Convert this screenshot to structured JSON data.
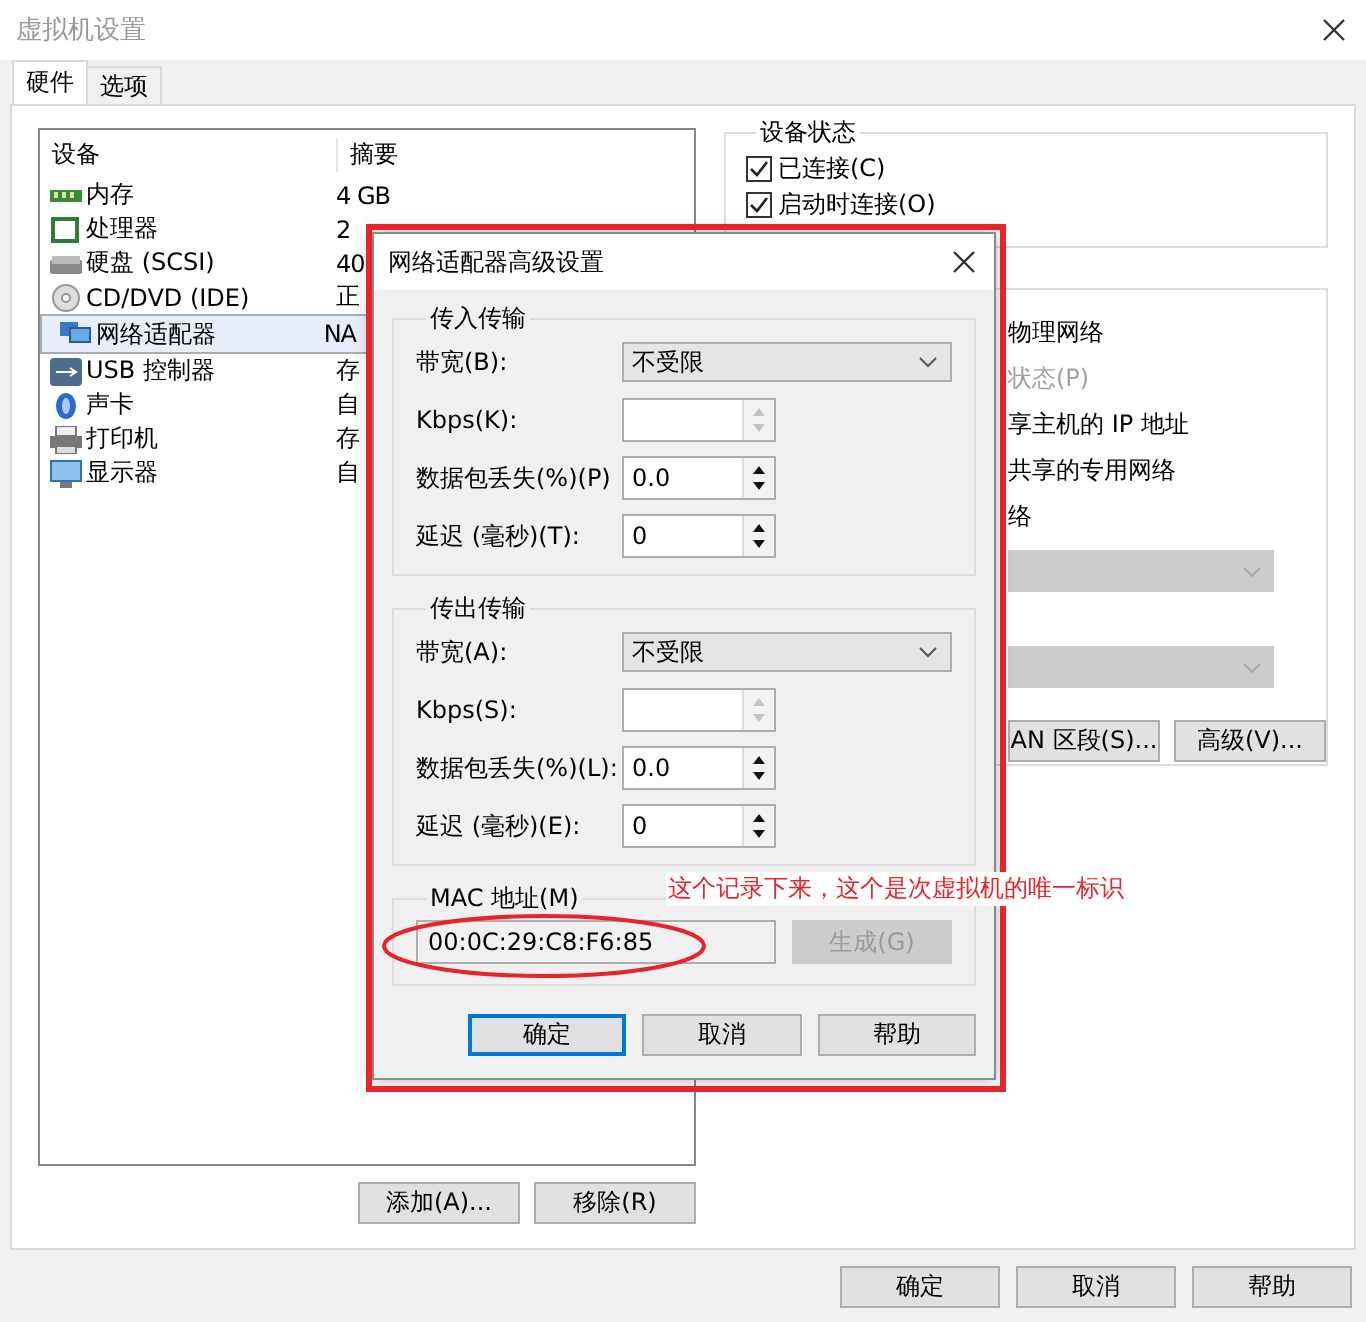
{
  "window": {
    "title": "虚拟机设置"
  },
  "tabs": [
    {
      "label": "硬件",
      "selected": true
    },
    {
      "label": "选项",
      "selected": false
    }
  ],
  "device_list": {
    "columns": [
      "设备",
      "摘要"
    ],
    "rows": [
      {
        "device": "内存",
        "summary": "4 GB",
        "selected": false
      },
      {
        "device": "处理器",
        "summary": "2",
        "selected": false
      },
      {
        "device": "硬盘 (SCSI)",
        "summary": "40",
        "selected": false
      },
      {
        "device": "CD/DVD (IDE)",
        "summary": "正",
        "selected": false
      },
      {
        "device": "网络适配器",
        "summary": "NA",
        "selected": true
      },
      {
        "device": "USB 控制器",
        "summary": "存",
        "selected": false
      },
      {
        "device": "声卡",
        "summary": "自",
        "selected": false
      },
      {
        "device": "打印机",
        "summary": "存",
        "selected": false
      },
      {
        "device": "显示器",
        "summary": "自",
        "selected": false
      }
    ]
  },
  "list_buttons": [
    "添加(A)...",
    "移除(R)"
  ],
  "device_status": {
    "title": "设备状态",
    "options": [
      {
        "label": "已连接(C)",
        "checked": true
      },
      {
        "label": "启动时连接(O)",
        "checked": true
      }
    ]
  },
  "connection": {
    "lines": [
      {
        "text": "物理网络",
        "disabled": false
      },
      {
        "text": "状态(P)",
        "disabled": true
      },
      {
        "text": "享主机的 IP 地址",
        "disabled": false
      },
      {
        "text": "共享的专用网络",
        "disabled": false
      },
      {
        "text": "络",
        "disabled": false
      }
    ],
    "dropdowns": [
      {
        "disabled": true
      },
      {
        "disabled": true
      }
    ],
    "buttons": [
      "AN 区段(S)...",
      "高级(V)..."
    ]
  },
  "footer_buttons": [
    "确定",
    "取消",
    "帮助"
  ],
  "dialog": {
    "title": "网络适配器高级设置",
    "groups": [
      {
        "title": "传入传输",
        "bandwidth": {
          "label": "带宽(B):",
          "value": "不受限"
        },
        "fields": [
          {
            "label": "Kbps(K):",
            "disabled": true
          },
          {
            "label": "数据包丢失(%)(P)",
            "value": "0.0",
            "disabled": false
          },
          {
            "label": "延迟 (毫秒)(T):",
            "value": "0",
            "disabled": false
          }
        ]
      },
      {
        "title": "传出传输",
        "bandwidth": {
          "label": "带宽(A):",
          "value": "不受限"
        },
        "fields": [
          {
            "label": "Kbps(S):",
            "disabled": true
          },
          {
            "label": "数据包丢失(%)(L):",
            "value": "0.0",
            "disabled": false
          },
          {
            "label": "延迟 (毫秒)(E):",
            "value": "0",
            "disabled": false
          }
        ]
      }
    ],
    "mac": {
      "label": "MAC 地址(M)",
      "value": "00:0C:29:C8:F6:85",
      "generate": {
        "label": "生成(G)",
        "disabled": true
      }
    },
    "buttons": [
      {
        "label": "确定",
        "focused": true
      },
      {
        "label": "取消",
        "focused": false
      },
      {
        "label": "帮助",
        "focused": false
      }
    ]
  },
  "annotation": "这个记录下来，这个是次虚拟机的唯一标识"
}
